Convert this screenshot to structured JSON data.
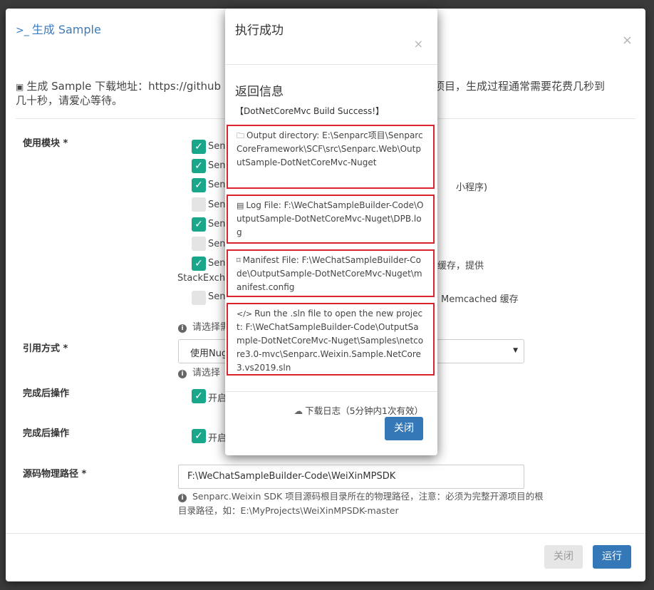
{
  "modal": {
    "title": "生成 Sample",
    "close_glyph": "×",
    "intro": "生成 Sample 下载地址：https://github.com/... 整项目，生成过程通常需要花费几秒到几十秒，请爱心等待。",
    "intro_visible_left": "生成 Sample 下载地址：https://github",
    "intro_visible_right": "整项目，生成过程通常需要花费几秒到",
    "intro_line2": "几十秒，请爱心等待。",
    "labels": {
      "modules": "使用模块 *",
      "reference": "引用方式 *",
      "after1": "完成后操作",
      "after2": "完成后操作",
      "source_path": "源码物理路径 *"
    },
    "checkboxes": [
      {
        "text": "Senp",
        "checked": true
      },
      {
        "text": "Senp",
        "checked": true
      },
      {
        "text": "Sen",
        "checked": true
      },
      {
        "text": "Sen",
        "checked": false
      },
      {
        "text": "Sen",
        "checked": true
      },
      {
        "text": "Sen",
        "checked": false
      },
      {
        "text": "Sen",
        "checked": true
      },
      {
        "text": "Sen",
        "checked": false
      }
    ],
    "row3_tail": "小程序)",
    "row7_tail": "缓存，提供",
    "row7_line2": "StackExcha",
    "row8_tail": "Memcached 缓存",
    "help1": "请选择需",
    "select_value": "使用Nug",
    "help2": "请选择",
    "after1_text": "开启",
    "after2_text": "开启",
    "source_path_value": "F:\\WeChatSampleBuilder-Code\\WeiXinMPSDK",
    "source_help": "Senparc.Weixin SDK 项目源码根目录所在的物理路径，注意：必须为完整开源项目的根目录路径，如：E:\\MyProjects\\WeiXinMPSDK-master",
    "btn_close": "关闭",
    "btn_run": "运行"
  },
  "popup": {
    "title": "执行成功",
    "close_glyph": "×",
    "subtitle": "返回信息",
    "message": "【DotNetCoreMvc Build Success!】",
    "boxes": [
      {
        "icon": "🗀",
        "text": "Output directory: E:\\Senparc项目\\SenparcCoreFramework\\SCF\\src\\Senparc.Web\\OutputSample-DotNetCoreMvc-Nuget"
      },
      {
        "icon": "▤",
        "text": "Log File: F:\\WeChatSampleBuilder-Code\\OutputSample-DotNetCoreMvc-Nuget\\DPB.log"
      },
      {
        "icon": "⌑",
        "text": "Manifest File: F:\\WeChatSampleBuilder-Code\\OutputSample-DotNetCoreMvc-Nuget\\manifest.config"
      },
      {
        "icon": "</>",
        "text": "Run the .sln file to open the new project: F:\\WeChatSampleBuilder-Code\\OutputSample-DotNetCoreMvc-Nuget\\Samples\\netcore3.0-mvc\\Senparc.Weixin.Sample.NetCore3.vs2019.sln"
      }
    ],
    "download": "下载日志（5分钟内1次有效）",
    "btn_close": "关闭"
  }
}
